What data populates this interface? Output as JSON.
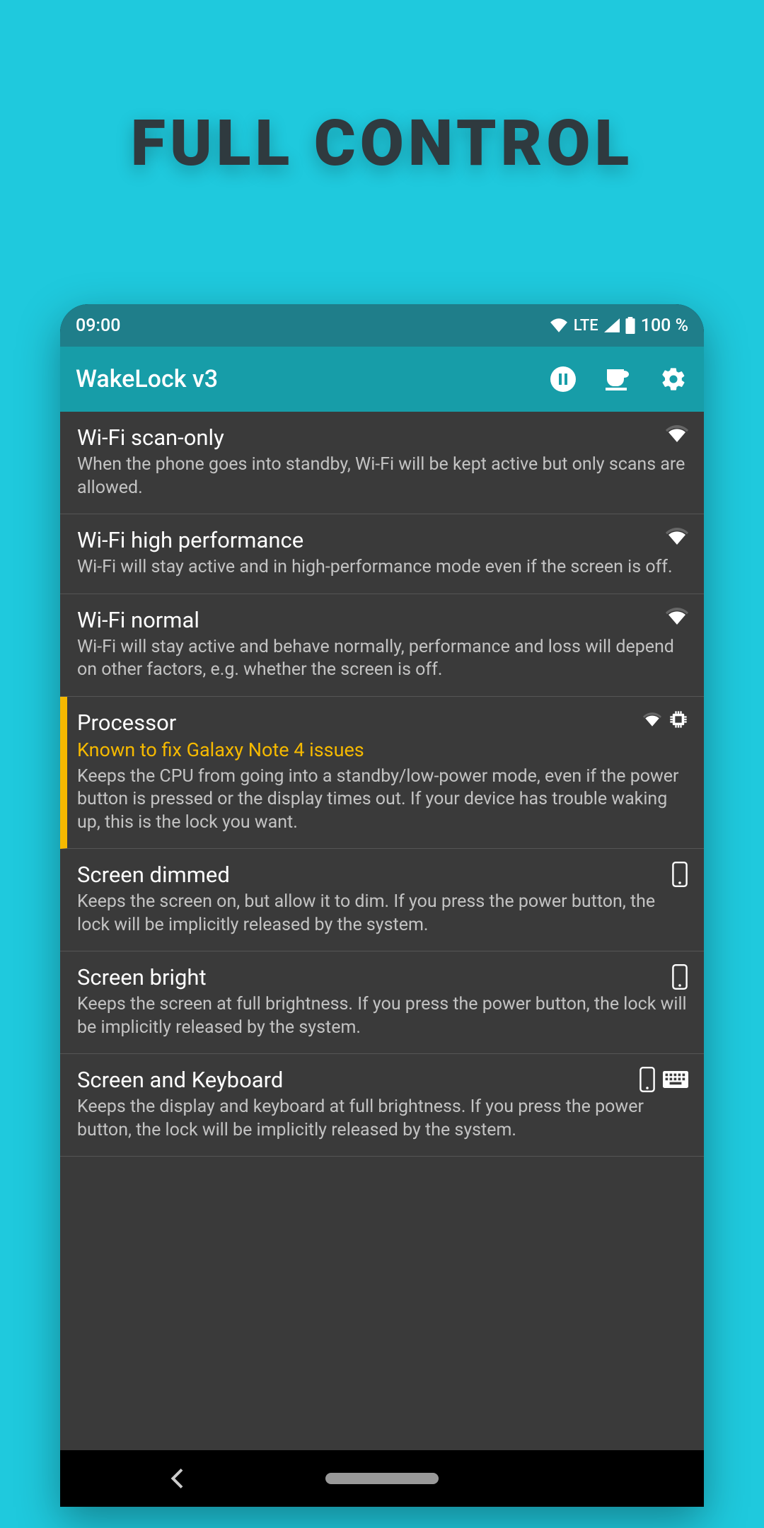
{
  "hero": "FULL CONTROL",
  "status": {
    "time": "09:00",
    "network": "LTE",
    "battery": "100 %"
  },
  "appbar": {
    "title": "WakeLock v3"
  },
  "rows": [
    {
      "title": "Wi-Fi scan-only",
      "desc": "When the phone goes into standby, Wi-Fi will be kept active but only scans are allowed.",
      "icons": [
        "wifi"
      ],
      "highlight": false,
      "sub": ""
    },
    {
      "title": "Wi-Fi high performance",
      "desc": "Wi-Fi will stay active and in high-performance mode even if the screen is off.",
      "icons": [
        "wifi"
      ],
      "highlight": false,
      "sub": ""
    },
    {
      "title": "Wi-Fi normal",
      "desc": "Wi-Fi will stay active and behave normally, performance and loss will depend on other factors, e.g. whether the screen is off.",
      "icons": [
        "wifi"
      ],
      "highlight": false,
      "sub": ""
    },
    {
      "title": "Processor",
      "sub": "Known to fix Galaxy Note 4 issues",
      "desc": "Keeps the CPU from going into a standby/low-power mode, even if the power button is pressed or the display times out. If your device has trouble waking up, this is the lock you want.",
      "icons": [
        "wifi-small",
        "cpu"
      ],
      "highlight": true
    },
    {
      "title": "Screen dimmed",
      "desc": "Keeps the screen on, but allow it to dim. If you press the power button, the lock will be implicitly released by the system.",
      "icons": [
        "phone"
      ],
      "highlight": false,
      "sub": ""
    },
    {
      "title": "Screen bright",
      "desc": "Keeps the screen at full brightness. If you press the power button, the lock will be implicitly released by the system.",
      "icons": [
        "phone"
      ],
      "highlight": false,
      "sub": ""
    },
    {
      "title": "Screen and Keyboard",
      "desc": "Keeps the display and keyboard at full brightness. If you press the power button, the lock will be implicitly released by the system.",
      "icons": [
        "phone",
        "keyboard"
      ],
      "highlight": false,
      "sub": ""
    }
  ]
}
